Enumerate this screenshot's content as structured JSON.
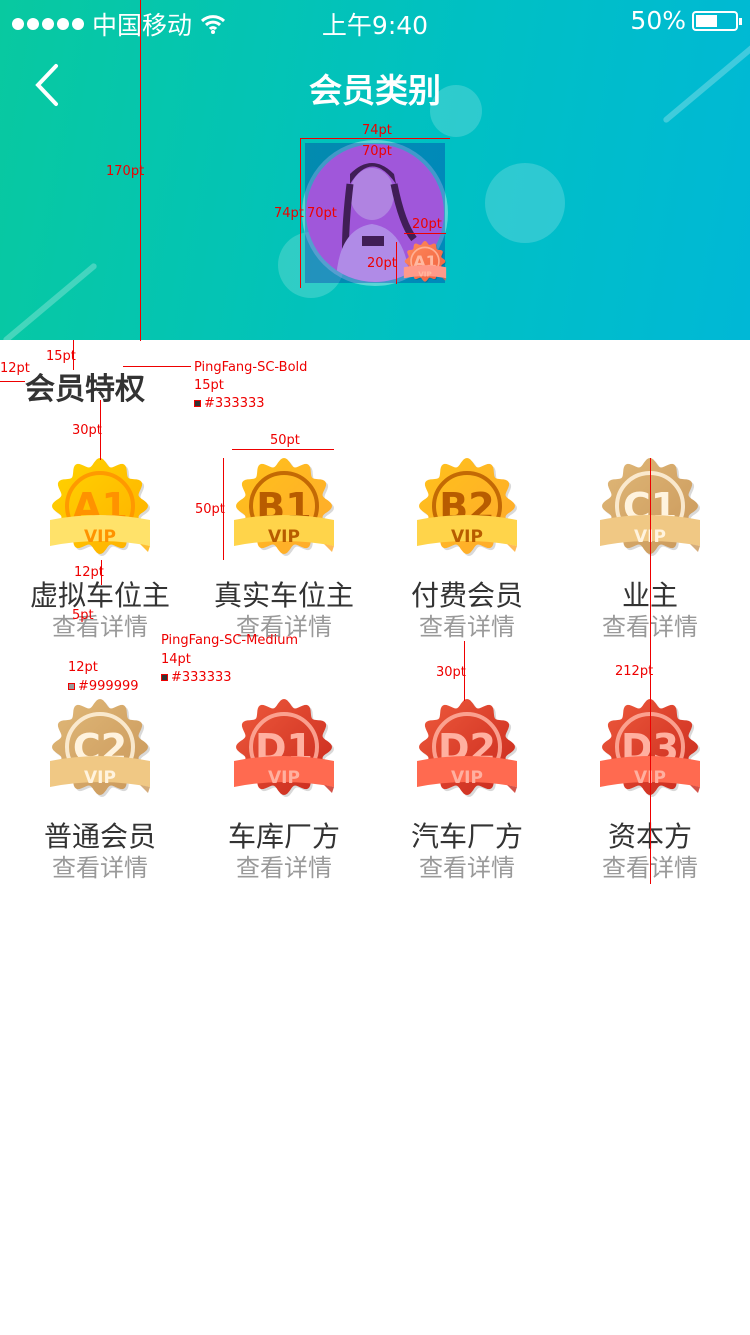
{
  "status_bar": {
    "carrier": "中国移动",
    "time": "上午9:40",
    "battery": "50%",
    "battery_level": 0.5
  },
  "header": {
    "title": "会员类别",
    "back_icon": "chevron-left-icon"
  },
  "avatar": {
    "badge_label": "A1",
    "badge_sub": "VIP"
  },
  "section": {
    "title": "会员特权"
  },
  "members": [
    {
      "code": "A1",
      "name": "虚拟车位主",
      "detail": "查看详情",
      "theme": "gold",
      "c1": "#ffd400",
      "c2": "#ffae00",
      "text": "#ff9200",
      "ribbon": "#ffe26a"
    },
    {
      "code": "B1",
      "name": "真实车位主",
      "detail": "查看详情",
      "theme": "gold",
      "c1": "#ffc21a",
      "c2": "#ffa92e",
      "text": "#b85c00",
      "ribbon": "#ffd44a"
    },
    {
      "code": "B2",
      "name": "付费会员",
      "detail": "查看详情",
      "theme": "gold",
      "c1": "#ffc21a",
      "c2": "#ffa92e",
      "text": "#b85c00",
      "ribbon": "#ffd44a"
    },
    {
      "code": "C1",
      "name": "业主",
      "detail": "查看详情",
      "theme": "tan",
      "c1": "#e0b878",
      "c2": "#c9975a",
      "text": "#fff3de",
      "ribbon": "#f0c884"
    },
    {
      "code": "C2",
      "name": "普通会员",
      "detail": "查看详情",
      "theme": "tan",
      "c1": "#e0b878",
      "c2": "#c9975a",
      "text": "#fff3de",
      "ribbon": "#f0c884"
    },
    {
      "code": "D1",
      "name": "车库厂方",
      "detail": "查看详情",
      "theme": "red",
      "c1": "#ee5a3c",
      "c2": "#c8281c",
      "text": "#ffb0a0",
      "ribbon": "#ff6a50"
    },
    {
      "code": "D2",
      "name": "汽车厂方",
      "detail": "查看详情",
      "theme": "red",
      "c1": "#ee5a3c",
      "c2": "#c8281c",
      "text": "#ffb0a0",
      "ribbon": "#ff6a50"
    },
    {
      "code": "D3",
      "name": "资本方",
      "detail": "查看详情",
      "theme": "red",
      "c1": "#ee5a3c",
      "c2": "#c8281c",
      "text": "#ffb0a0",
      "ribbon": "#ff6a50"
    }
  ],
  "badge_sub": "VIP",
  "annotations": {
    "header_h": "170pt",
    "avatar_outer_w": "74pt",
    "avatar_inner_w": "70pt",
    "avatar_outer_h": "74pt",
    "avatar_inner_h": "70pt",
    "mini_w": "20pt",
    "mini_h": "20pt",
    "left_margin": "12pt",
    "top_margin": "15pt",
    "title_font": "PingFang-SC-Bold",
    "title_size": "15pt",
    "title_color": "#333333",
    "badge_gap": "30pt",
    "badge_w": "50pt",
    "badge_h": "50pt",
    "name_gap": "12pt",
    "detail_gap": "5pt",
    "name_font": "PingFang-SC-Medium",
    "name_size": "14pt",
    "name_color": "#333333",
    "detail_size": "12pt",
    "detail_color": "#999999",
    "row_gap": "30pt",
    "grid_h": "212pt"
  }
}
